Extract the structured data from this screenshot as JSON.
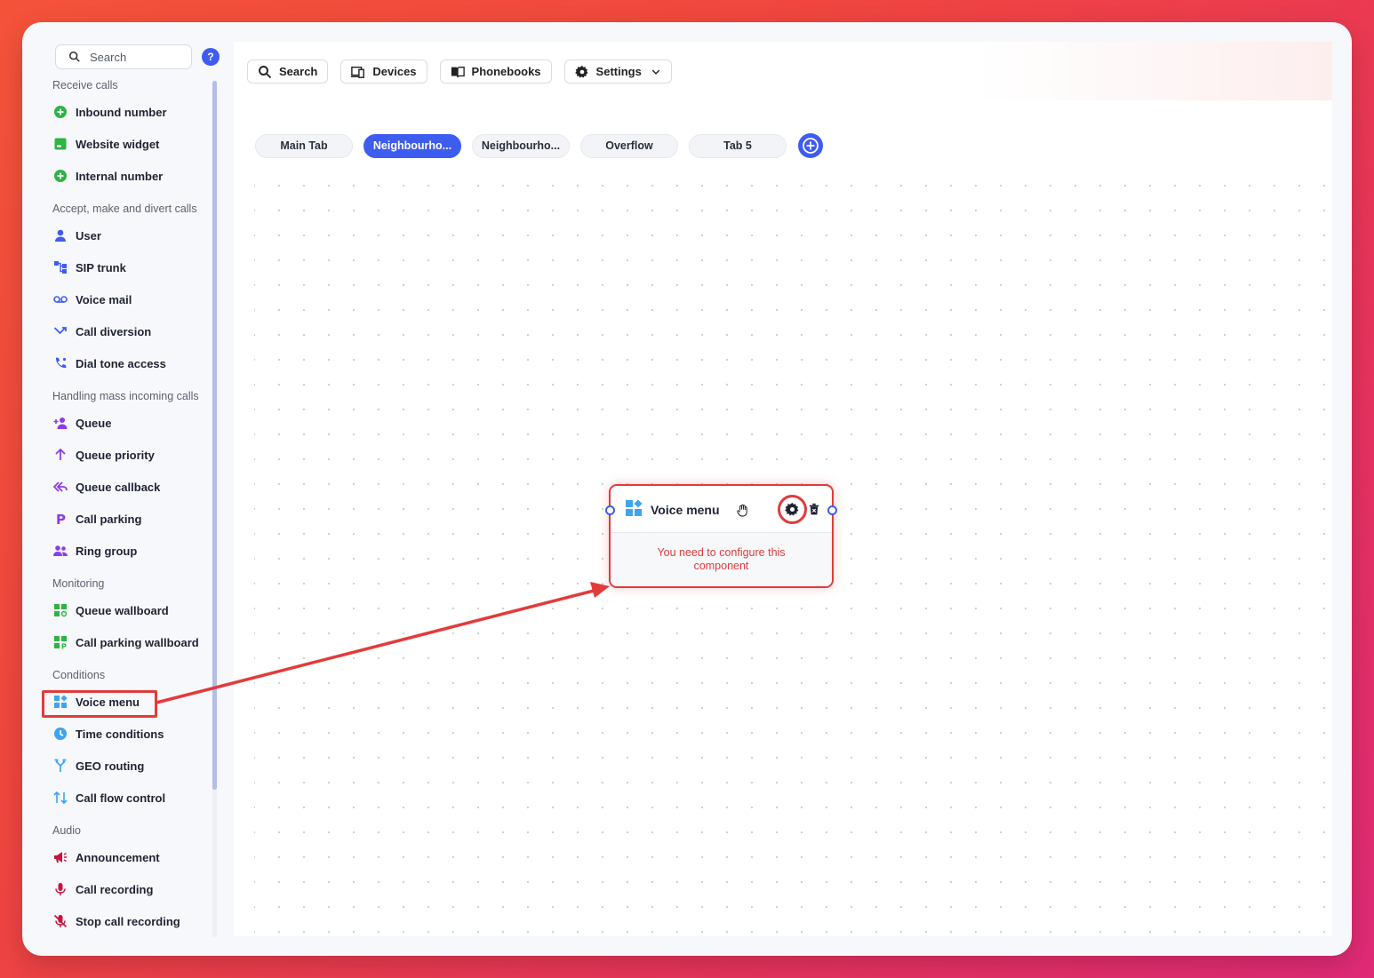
{
  "sidebar": {
    "search_placeholder": "Search",
    "help_label": "?",
    "sections": {
      "receive": "Receive calls",
      "accept": "Accept, make and divert calls",
      "mass": "Handling mass incoming calls",
      "monitoring": "Monitoring",
      "conditions": "Conditions",
      "audio": "Audio"
    },
    "items": {
      "inbound_number": "Inbound number",
      "website_widget": "Website widget",
      "internal_number": "Internal number",
      "user": "User",
      "sip_trunk": "SIP trunk",
      "voice_mail": "Voice mail",
      "call_diversion": "Call diversion",
      "dial_tone_access": "Dial tone access",
      "queue": "Queue",
      "queue_priority": "Queue priority",
      "queue_callback": "Queue callback",
      "call_parking": "Call parking",
      "ring_group": "Ring group",
      "queue_wallboard": "Queue wallboard",
      "call_parking_wallboard": "Call parking wallboard",
      "voice_menu": "Voice menu",
      "time_conditions": "Time conditions",
      "geo_routing": "GEO routing",
      "call_flow_control": "Call flow control",
      "announcement": "Announcement",
      "call_recording": "Call recording",
      "stop_call_recording": "Stop call recording"
    }
  },
  "toolbar": {
    "search": "Search",
    "devices": "Devices",
    "phonebooks": "Phonebooks",
    "settings": "Settings"
  },
  "tabs": [
    "Main Tab",
    "Neighbourho...",
    "Neighbourho...",
    "Overflow",
    "Tab 5"
  ],
  "node": {
    "title": "Voice menu",
    "message": "You need to configure this component"
  },
  "colors": {
    "accent": "#3e5df0",
    "error": "#e23b3b",
    "green": "#2fb344",
    "purple": "#8a3ee6",
    "crimson": "#c4163f",
    "sky": "#3fa4f0"
  }
}
